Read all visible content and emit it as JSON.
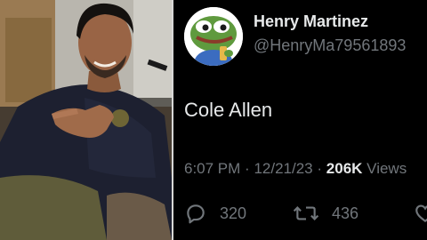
{
  "photo": {
    "description_icon": "person-photo"
  },
  "tweet": {
    "display_name": "Henry Martinez",
    "handle": "@HenryMa79561893",
    "text": "Cole Allen",
    "time": "6:07 PM",
    "separator": "·",
    "date": "12/21/23",
    "views_count": "206K",
    "views_label": "Views",
    "replies": "320",
    "reposts": "436"
  },
  "icons": {
    "reply": "reply-icon",
    "repost": "repost-icon",
    "like": "like-icon"
  },
  "colors": {
    "background": "#000000",
    "text": "#e7e9ea",
    "muted": "#71767b"
  }
}
